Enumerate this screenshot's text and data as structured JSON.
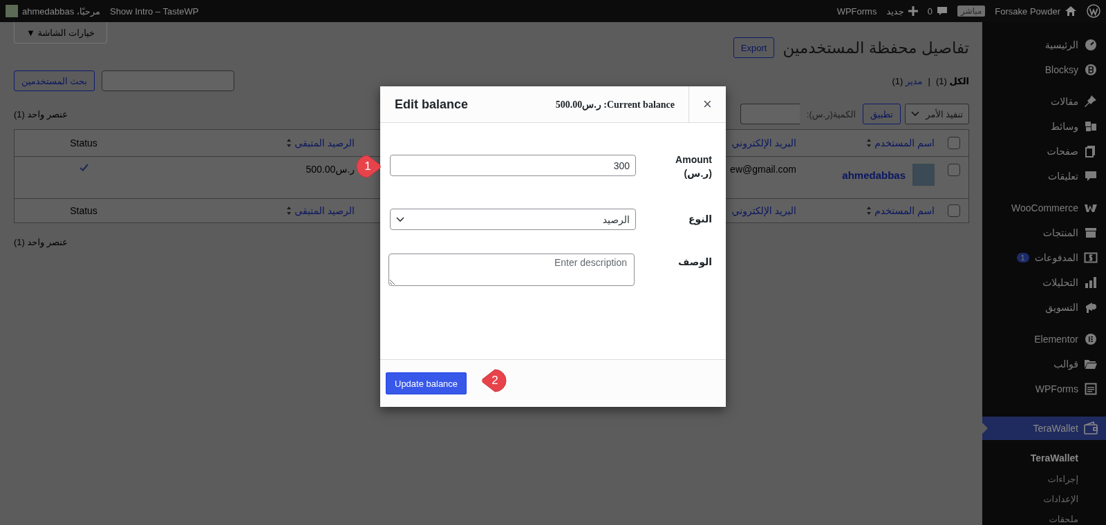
{
  "admin_bar": {
    "site_name": "Forsake Powder",
    "live_badge": "مباشر",
    "comments_count": "0",
    "new_label": "جديد",
    "plugin_link": "WPForms",
    "site_title": "Show Intro – TasteWP",
    "greeting": "مرحبًا، ahmedabbas"
  },
  "sidebar": {
    "groups": [
      [
        {
          "label": "الرئيسية",
          "selected": false
        },
        {
          "label": "Blocksy",
          "selected": false
        }
      ],
      [
        {
          "label": "مقالات",
          "selected": false
        },
        {
          "label": "وسائط",
          "selected": false
        },
        {
          "label": "صفحات",
          "selected": false
        },
        {
          "label": "تعليقات",
          "selected": false
        }
      ],
      [
        {
          "label": "WooCommerce",
          "selected": false
        },
        {
          "label": "المنتجات",
          "selected": false
        },
        {
          "label": "المدفوعات",
          "badge": "1",
          "selected": false
        },
        {
          "label": "التحليلات",
          "selected": false
        },
        {
          "label": "التسويق",
          "selected": false
        }
      ],
      [
        {
          "label": "Elementor",
          "selected": false
        },
        {
          "label": "قوالب",
          "selected": false
        },
        {
          "label": "WPForms",
          "selected": false
        }
      ],
      [
        {
          "label": "TeraWallet",
          "selected": true
        }
      ]
    ],
    "submenu": [
      {
        "label": "TeraWallet",
        "selected": true
      },
      {
        "label": "إجراءات",
        "selected": false
      },
      {
        "label": "الإعدادات",
        "selected": false
      },
      {
        "label": "ملحقات",
        "selected": false
      }
    ]
  },
  "page": {
    "screen_options": "خيارات الشاشة ▼",
    "title": "تفاصيل محفظة المستخدمين",
    "export_button": "Export",
    "views": [
      {
        "label": "الكل",
        "count": "(1)",
        "selected": true
      },
      {
        "label": "مدير",
        "count": "(1)",
        "selected": false
      }
    ],
    "views_separator": "|",
    "search_button": "بحث المستخدمين",
    "bulk_action": "تنفيذ الأمر",
    "apply_button": "تطبيق",
    "amount_label": "الكمية(ر.س):",
    "items_count_top": "عنصر واحد (1)",
    "items_count_bottom": "عنصر واحد (1)",
    "table": {
      "header_columns": [
        {
          "label": "اسم المستخدم",
          "sortable": true
        },
        {
          "label": "البريد الإلكتروني",
          "sortable": false
        },
        {
          "label": "الرصيد المتبقى",
          "sortable": true
        },
        {
          "label": "Status",
          "sortable": false
        }
      ],
      "footer_columns": [
        {
          "label": "اسم المستخدم",
          "sortable": true
        },
        {
          "label": "البريد الإلكتروني",
          "sortable": false
        },
        {
          "label": "الرصيد المتبقى",
          "sortable": true
        },
        {
          "label": "Status",
          "sortable": false
        }
      ],
      "header_checked": false,
      "footer_checked": false,
      "rows": [
        {
          "checked": false,
          "username": "ahmedabbas",
          "email": "ew@gmail.com",
          "balance": "ر.س500.00",
          "active": true
        }
      ]
    }
  },
  "modal": {
    "title": "Edit balance",
    "current_balance": "Current balance: ر.س500.00",
    "close": "×",
    "amount_label": "Amount (ر.س)",
    "amount_value": "300",
    "type_label": "النوع",
    "type_value": "الرصيد",
    "description_label": "الوصف",
    "description_placeholder": "Enter description",
    "submit": "Update balance"
  },
  "callouts": [
    {
      "number": "1"
    },
    {
      "number": "2"
    }
  ]
}
